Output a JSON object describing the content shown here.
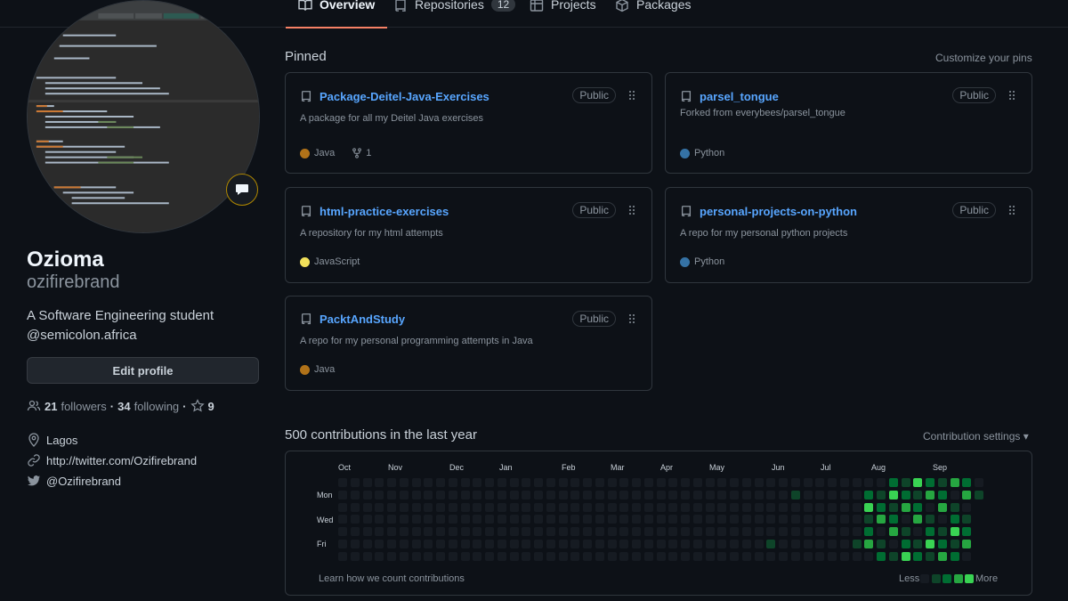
{
  "tabs": [
    {
      "label": "Overview",
      "active": true,
      "icon": "book-icon"
    },
    {
      "label": "Repositories",
      "count": "12",
      "icon": "repo-icon"
    },
    {
      "label": "Projects",
      "icon": "table-icon"
    },
    {
      "label": "Packages",
      "icon": "package-icon"
    }
  ],
  "profile": {
    "name": "Ozioma",
    "login": "ozifirebrand",
    "bio_line1": "A Software Engineering student",
    "bio_line2": "@semicolon.africa",
    "edit_label": "Edit profile",
    "followers_count": "21",
    "followers_label": "followers",
    "separator": "·",
    "following_count": "34",
    "following_label": "following",
    "stars_count": "9",
    "location": "Lagos",
    "website": "http://twitter.com/Ozifirebrand",
    "twitter": "@Ozifirebrand"
  },
  "pinned": {
    "title": "Pinned",
    "customize": "Customize your pins",
    "cards": [
      {
        "name": "Package-Deitel-Java-Exercises",
        "visibility": "Public",
        "description": "A package for all my Deitel Java exercises",
        "language": "Java",
        "lang_color": "#b07219",
        "forks": "1"
      },
      {
        "name": "parsel_tongue",
        "visibility": "Public",
        "description": "Forked from everybees/parsel_tongue",
        "language": "Python",
        "lang_color": "#3572a5"
      },
      {
        "name": "html-practice-exercises",
        "visibility": "Public",
        "description": "A repository for my html attempts",
        "language": "JavaScript",
        "lang_color": "#f1e05a"
      },
      {
        "name": "personal-projects-on-python",
        "visibility": "Public",
        "description": "A repo for my personal python projects",
        "language": "Python",
        "lang_color": "#3572a5"
      },
      {
        "name": "PacktAndStudy",
        "visibility": "Public",
        "description": "A repo for my personal programming attempts in Java",
        "language": "Java",
        "lang_color": "#b07219"
      }
    ]
  },
  "contributions": {
    "title": "500 contributions in the last year",
    "settings": "Contribution settings ▾",
    "months": [
      "Oct",
      "Nov",
      "Dec",
      "Jan",
      "Feb",
      "Mar",
      "Apr",
      "May",
      "Jun",
      "Jul",
      "Aug",
      "Sep"
    ],
    "days": [
      "Mon",
      "Wed",
      "Fri"
    ],
    "learn": "Learn how we count contributions",
    "less": "Less",
    "more": "More",
    "colors": [
      "#161b22",
      "#0e4429",
      "#006d32",
      "#26a641",
      "#39d353"
    ]
  }
}
